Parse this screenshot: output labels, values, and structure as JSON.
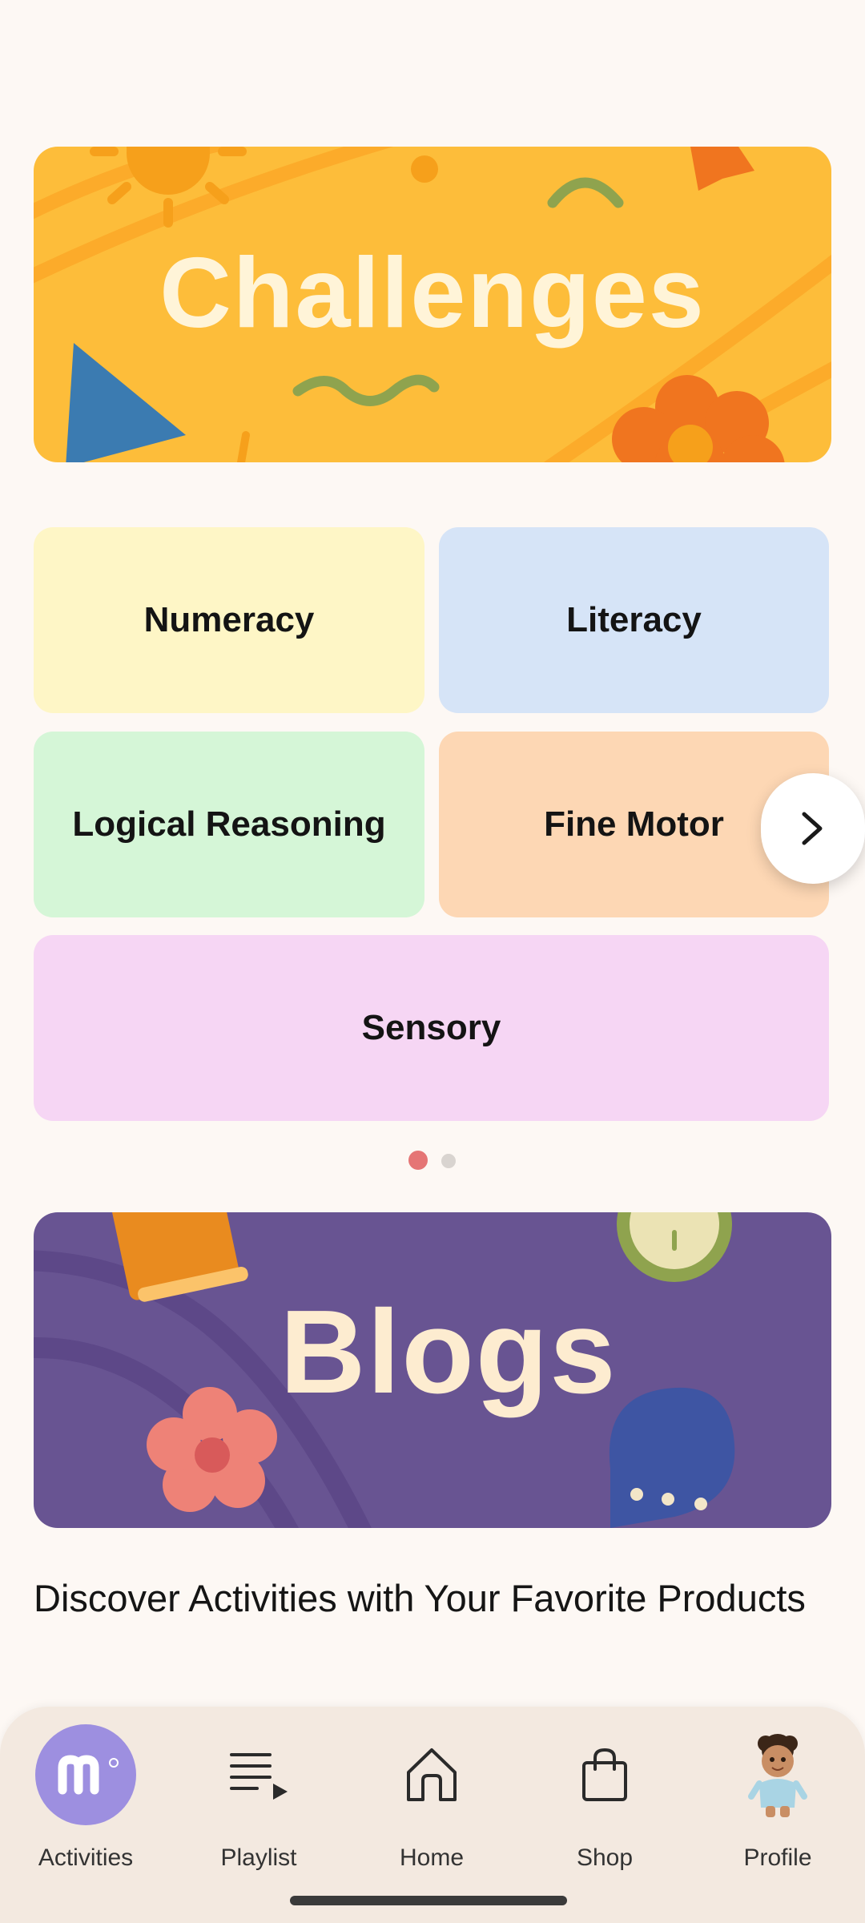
{
  "banners": {
    "challenges": "Challenges",
    "blogs": "Blogs"
  },
  "categories": [
    {
      "label": "Numeracy",
      "color": "#fef6c6"
    },
    {
      "label": "Literacy",
      "color": "#d6e4f7"
    },
    {
      "label": "Logical Reasoning",
      "color": "#d5f6d7"
    },
    {
      "label": "Fine Motor",
      "color": "#fdd7b4"
    },
    {
      "label": "Sensory",
      "color": "#f6d6f4"
    }
  ],
  "pagination": {
    "pages": 2,
    "active": 1
  },
  "section": {
    "heading": "Discover Activities with Your Favorite Products"
  },
  "nav": [
    {
      "label": "Activities",
      "icon": "activities-logo-icon",
      "active": true
    },
    {
      "label": "Playlist",
      "icon": "playlist-icon",
      "active": false
    },
    {
      "label": "Home",
      "icon": "home-icon",
      "active": false
    },
    {
      "label": "Shop",
      "icon": "shopping-bag-icon",
      "active": false
    },
    {
      "label": "Profile",
      "icon": "profile-avatar-icon",
      "active": false
    }
  ],
  "colors": {
    "background": "#fdf8f4",
    "challenges_banner": "#fdbd3a",
    "blogs_banner": "#685492",
    "active_nav": "#9d8fe0",
    "dot_active": "#e57575",
    "dot_inactive": "#d9d4d0"
  }
}
